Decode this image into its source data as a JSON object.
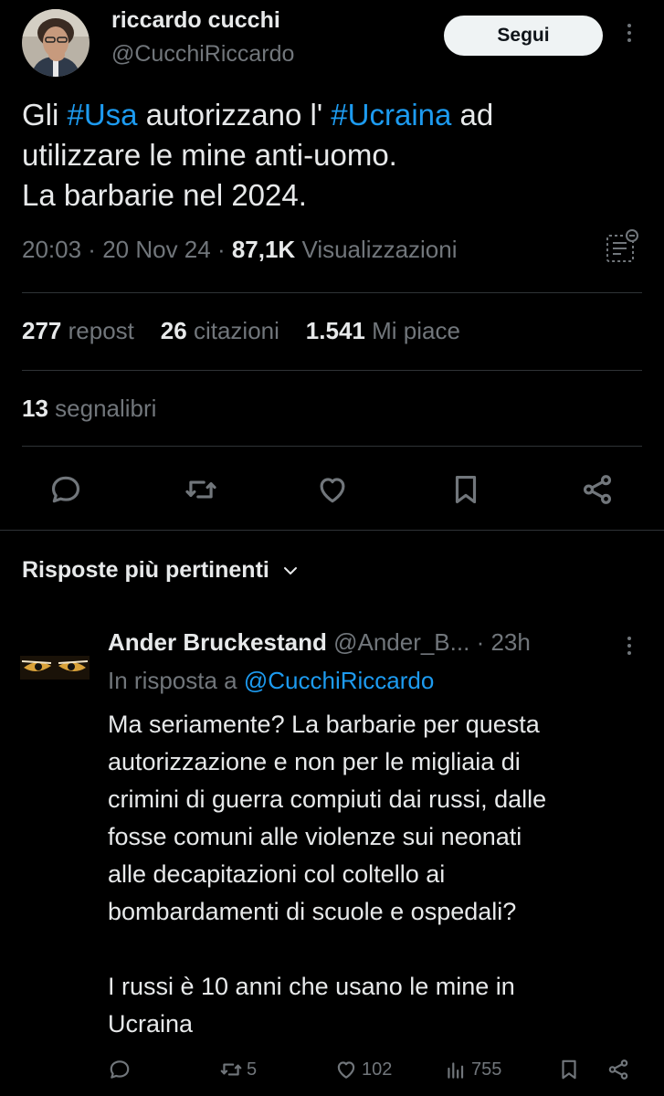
{
  "author": {
    "name": "riccardo cucchi",
    "handle": "@CucchiRiccardo",
    "follow_label": "Segui"
  },
  "tweet": {
    "line1_prefix": "Gli ",
    "hashtag1": "#Usa",
    "line1_mid": " autorizzano l' ",
    "hashtag2": "#Ucraina",
    "line1_suffix": " ad",
    "line2": "utilizzare le mine anti-uomo.",
    "line3": "La barbarie nel 2024.",
    "time": "20:03",
    "date": "20 Nov 24",
    "views_count": "87,1K",
    "views_label": "Visualizzazioni"
  },
  "stats": {
    "reposts_count": "277",
    "reposts_label": "repost",
    "quotes_count": "26",
    "quotes_label": "citazioni",
    "likes_count": "1.541",
    "likes_label": "Mi piace",
    "bookmarks_count": "13",
    "bookmarks_label": "segnalibri"
  },
  "replies_section": {
    "title": "Risposte più pertinenti"
  },
  "reply": {
    "name": "Ander Bruckestand",
    "handle": "@Ander_B...",
    "time": "23h",
    "in_reply_label": "In risposta a",
    "in_reply_handle": "@CucchiRiccardo",
    "lines": [
      "Ma seriamente? La barbarie per questa",
      "autorizzazione e non per le migliaia di",
      "crimini di guerra compiuti dai russi, dalle",
      "fosse comuni alle violenze sui neonati",
      "alle decapitazioni col coltello ai",
      "bombardamenti di scuole e ospedali?",
      "",
      "I russi è 10 anni che usano le mine in",
      "Ucraina"
    ],
    "reposts": "5",
    "likes": "102",
    "views": "755"
  },
  "icons": {
    "reply": "reply-icon",
    "repost": "repost-icon",
    "like": "heart-icon",
    "bookmark": "bookmark-icon",
    "share": "share-icon",
    "views": "analytics-icon",
    "more": "more-icon",
    "chevron": "chevron-down-icon"
  },
  "colors": {
    "background": "#000000",
    "text": "#e7e9ea",
    "muted": "#71767b",
    "link": "#1d9bf0",
    "button_bg": "#eff3f4"
  }
}
